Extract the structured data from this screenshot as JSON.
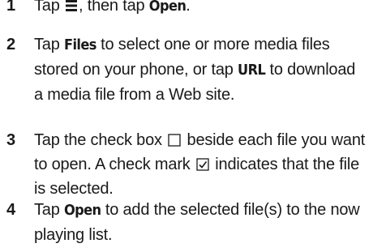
{
  "steps": [
    {
      "number": "1",
      "parts": {
        "a": "Tap ",
        "b": ", then tap ",
        "c": "Open",
        "d": "."
      }
    },
    {
      "number": "2",
      "parts": {
        "a": "Tap ",
        "b": "Files",
        "c": " to select one or more media files stored on your phone, or tap ",
        "d": "URL",
        "e": " to download a media file from a Web site."
      }
    },
    {
      "number": "3",
      "parts": {
        "a": "Tap the check box ",
        "b": " beside each file you want to open. A check mark ",
        "c": " indicates that the file is selected."
      }
    },
    {
      "number": "4",
      "parts": {
        "a": "Tap ",
        "b": "Open",
        "c": " to add the selected file(s) to the now playing list."
      }
    }
  ],
  "icons": {
    "menu": "menu-icon",
    "checkbox": "checkbox-empty-icon",
    "checked": "checkbox-checked-icon"
  }
}
